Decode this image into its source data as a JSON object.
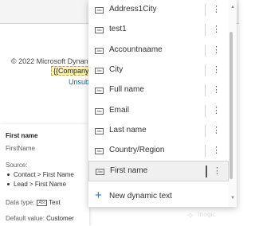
{
  "background": {
    "footer_copyright": "© 2022 Microsoft Dynan",
    "placeholder_token": "{{Company",
    "unsubscribe_text": "Unsub"
  },
  "details": {
    "title": "First name",
    "logical_name": "FirstName",
    "source_label": "Source:",
    "sources": [
      "Contact > First Name",
      "Lead > First Name"
    ],
    "data_type_label": "Data type:",
    "data_type_icon": "text-field-icon",
    "data_type_value": "Text",
    "default_value_label": "Default value:",
    "default_value": "Customer"
  },
  "dropdown": {
    "field_icon_text": "Abc",
    "items": [
      {
        "label": "Address1City"
      },
      {
        "label": "test1"
      },
      {
        "label": "Accountnaame"
      },
      {
        "label": "City"
      },
      {
        "label": "Full name"
      },
      {
        "label": "Email"
      },
      {
        "label": "Last name"
      },
      {
        "label": "Country/Region"
      },
      {
        "label": "First name",
        "selected": true
      }
    ],
    "more_glyph": "⋮",
    "new_button_label": "New dynamic text",
    "new_button_glyph": "+"
  },
  "watermark": {
    "glyph": "✧",
    "text": "Inogic"
  },
  "colors": {
    "accent": "#0078d4",
    "placeholder_highlight": "#fdf3b5",
    "selected_row": "#f0f0f0",
    "link": "#0067b8"
  }
}
